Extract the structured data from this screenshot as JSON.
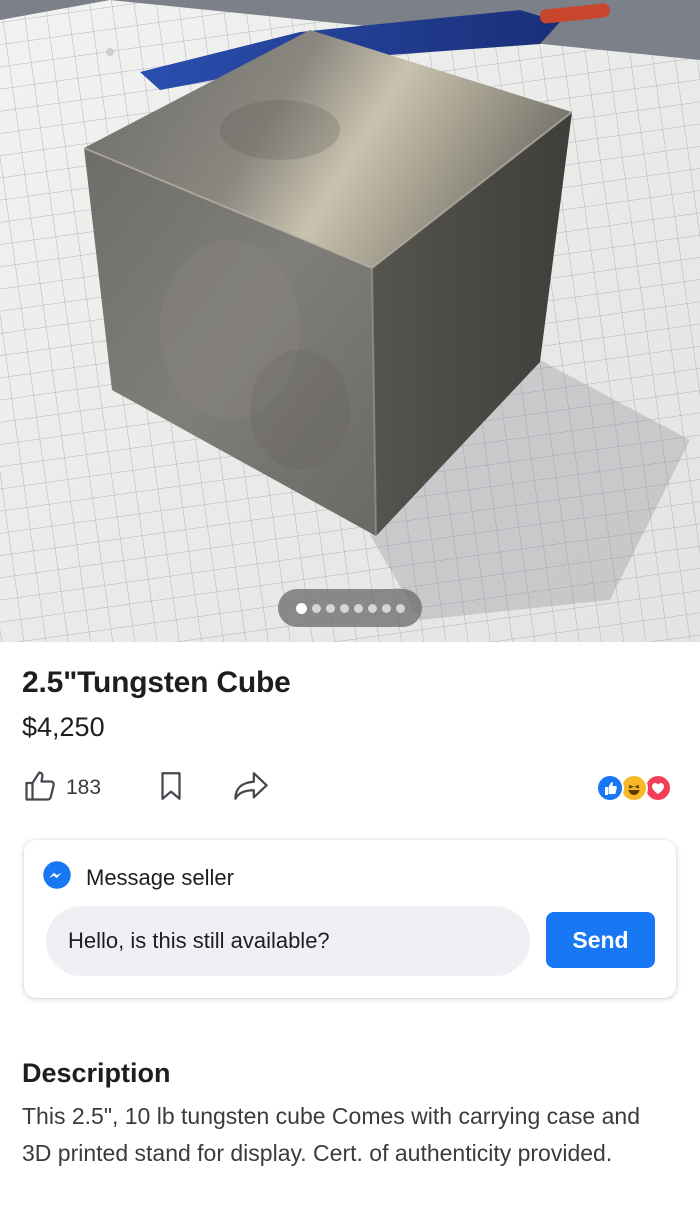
{
  "listing": {
    "title": "2.5\"Tungsten Cube",
    "price": "$4,250",
    "photo": {
      "subject": "tungsten-cube-photo",
      "page_count": 8,
      "current_page": 1
    }
  },
  "actions": {
    "like_icon": "thumbs-up-icon",
    "like_count": "183",
    "save_icon": "bookmark-icon",
    "share_icon": "share-arrow-icon"
  },
  "reactions": [
    {
      "icon": "like-reaction-icon",
      "color": "#1877f2"
    },
    {
      "icon": "haha-reaction-icon",
      "color": "#f7b928"
    },
    {
      "icon": "love-reaction-icon",
      "color": "#f33e58"
    }
  ],
  "message": {
    "icon": "messenger-icon",
    "label": "Message seller",
    "input_value": "Hello, is this still available?",
    "send_label": "Send"
  },
  "description": {
    "heading": "Description",
    "body": "This 2.5\", 10 lb tungsten cube Comes with carrying case and 3D printed stand for display. Cert. of authenticity provided."
  },
  "colors": {
    "accent": "#1877f2",
    "text": "#1c1e21",
    "secondary_text": "#3a3b3c",
    "input_bg": "#eef0f3"
  }
}
